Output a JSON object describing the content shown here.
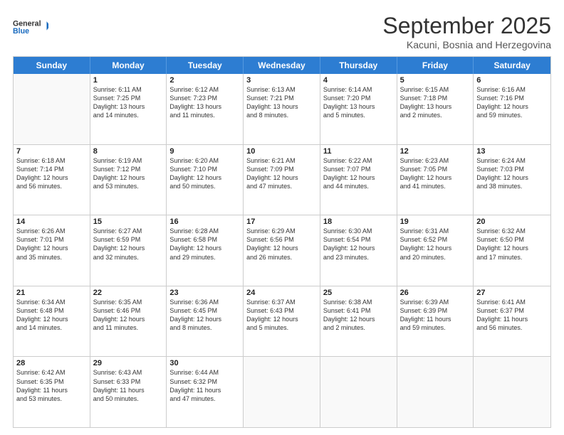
{
  "logo": {
    "line1": "General",
    "line2": "Blue"
  },
  "title": "September 2025",
  "location": "Kacuni, Bosnia and Herzegovina",
  "days": [
    "Sunday",
    "Monday",
    "Tuesday",
    "Wednesday",
    "Thursday",
    "Friday",
    "Saturday"
  ],
  "rows": [
    [
      {
        "num": "",
        "lines": [],
        "empty": true
      },
      {
        "num": "1",
        "lines": [
          "Sunrise: 6:11 AM",
          "Sunset: 7:25 PM",
          "Daylight: 13 hours",
          "and 14 minutes."
        ]
      },
      {
        "num": "2",
        "lines": [
          "Sunrise: 6:12 AM",
          "Sunset: 7:23 PM",
          "Daylight: 13 hours",
          "and 11 minutes."
        ]
      },
      {
        "num": "3",
        "lines": [
          "Sunrise: 6:13 AM",
          "Sunset: 7:21 PM",
          "Daylight: 13 hours",
          "and 8 minutes."
        ]
      },
      {
        "num": "4",
        "lines": [
          "Sunrise: 6:14 AM",
          "Sunset: 7:20 PM",
          "Daylight: 13 hours",
          "and 5 minutes."
        ]
      },
      {
        "num": "5",
        "lines": [
          "Sunrise: 6:15 AM",
          "Sunset: 7:18 PM",
          "Daylight: 13 hours",
          "and 2 minutes."
        ]
      },
      {
        "num": "6",
        "lines": [
          "Sunrise: 6:16 AM",
          "Sunset: 7:16 PM",
          "Daylight: 12 hours",
          "and 59 minutes."
        ]
      }
    ],
    [
      {
        "num": "7",
        "lines": [
          "Sunrise: 6:18 AM",
          "Sunset: 7:14 PM",
          "Daylight: 12 hours",
          "and 56 minutes."
        ]
      },
      {
        "num": "8",
        "lines": [
          "Sunrise: 6:19 AM",
          "Sunset: 7:12 PM",
          "Daylight: 12 hours",
          "and 53 minutes."
        ]
      },
      {
        "num": "9",
        "lines": [
          "Sunrise: 6:20 AM",
          "Sunset: 7:10 PM",
          "Daylight: 12 hours",
          "and 50 minutes."
        ]
      },
      {
        "num": "10",
        "lines": [
          "Sunrise: 6:21 AM",
          "Sunset: 7:09 PM",
          "Daylight: 12 hours",
          "and 47 minutes."
        ]
      },
      {
        "num": "11",
        "lines": [
          "Sunrise: 6:22 AM",
          "Sunset: 7:07 PM",
          "Daylight: 12 hours",
          "and 44 minutes."
        ]
      },
      {
        "num": "12",
        "lines": [
          "Sunrise: 6:23 AM",
          "Sunset: 7:05 PM",
          "Daylight: 12 hours",
          "and 41 minutes."
        ]
      },
      {
        "num": "13",
        "lines": [
          "Sunrise: 6:24 AM",
          "Sunset: 7:03 PM",
          "Daylight: 12 hours",
          "and 38 minutes."
        ]
      }
    ],
    [
      {
        "num": "14",
        "lines": [
          "Sunrise: 6:26 AM",
          "Sunset: 7:01 PM",
          "Daylight: 12 hours",
          "and 35 minutes."
        ]
      },
      {
        "num": "15",
        "lines": [
          "Sunrise: 6:27 AM",
          "Sunset: 6:59 PM",
          "Daylight: 12 hours",
          "and 32 minutes."
        ]
      },
      {
        "num": "16",
        "lines": [
          "Sunrise: 6:28 AM",
          "Sunset: 6:58 PM",
          "Daylight: 12 hours",
          "and 29 minutes."
        ]
      },
      {
        "num": "17",
        "lines": [
          "Sunrise: 6:29 AM",
          "Sunset: 6:56 PM",
          "Daylight: 12 hours",
          "and 26 minutes."
        ]
      },
      {
        "num": "18",
        "lines": [
          "Sunrise: 6:30 AM",
          "Sunset: 6:54 PM",
          "Daylight: 12 hours",
          "and 23 minutes."
        ]
      },
      {
        "num": "19",
        "lines": [
          "Sunrise: 6:31 AM",
          "Sunset: 6:52 PM",
          "Daylight: 12 hours",
          "and 20 minutes."
        ]
      },
      {
        "num": "20",
        "lines": [
          "Sunrise: 6:32 AM",
          "Sunset: 6:50 PM",
          "Daylight: 12 hours",
          "and 17 minutes."
        ]
      }
    ],
    [
      {
        "num": "21",
        "lines": [
          "Sunrise: 6:34 AM",
          "Sunset: 6:48 PM",
          "Daylight: 12 hours",
          "and 14 minutes."
        ]
      },
      {
        "num": "22",
        "lines": [
          "Sunrise: 6:35 AM",
          "Sunset: 6:46 PM",
          "Daylight: 12 hours",
          "and 11 minutes."
        ]
      },
      {
        "num": "23",
        "lines": [
          "Sunrise: 6:36 AM",
          "Sunset: 6:45 PM",
          "Daylight: 12 hours",
          "and 8 minutes."
        ]
      },
      {
        "num": "24",
        "lines": [
          "Sunrise: 6:37 AM",
          "Sunset: 6:43 PM",
          "Daylight: 12 hours",
          "and 5 minutes."
        ]
      },
      {
        "num": "25",
        "lines": [
          "Sunrise: 6:38 AM",
          "Sunset: 6:41 PM",
          "Daylight: 12 hours",
          "and 2 minutes."
        ]
      },
      {
        "num": "26",
        "lines": [
          "Sunrise: 6:39 AM",
          "Sunset: 6:39 PM",
          "Daylight: 11 hours",
          "and 59 minutes."
        ]
      },
      {
        "num": "27",
        "lines": [
          "Sunrise: 6:41 AM",
          "Sunset: 6:37 PM",
          "Daylight: 11 hours",
          "and 56 minutes."
        ]
      }
    ],
    [
      {
        "num": "28",
        "lines": [
          "Sunrise: 6:42 AM",
          "Sunset: 6:35 PM",
          "Daylight: 11 hours",
          "and 53 minutes."
        ]
      },
      {
        "num": "29",
        "lines": [
          "Sunrise: 6:43 AM",
          "Sunset: 6:33 PM",
          "Daylight: 11 hours",
          "and 50 minutes."
        ]
      },
      {
        "num": "30",
        "lines": [
          "Sunrise: 6:44 AM",
          "Sunset: 6:32 PM",
          "Daylight: 11 hours",
          "and 47 minutes."
        ]
      },
      {
        "num": "",
        "lines": [],
        "empty": true
      },
      {
        "num": "",
        "lines": [],
        "empty": true
      },
      {
        "num": "",
        "lines": [],
        "empty": true
      },
      {
        "num": "",
        "lines": [],
        "empty": true
      }
    ]
  ]
}
